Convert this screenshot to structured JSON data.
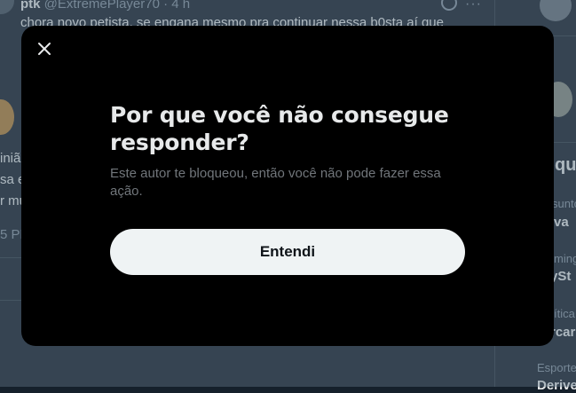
{
  "background": {
    "tweet": {
      "author_name": "ptk",
      "author_handle": "@ExtremePlayer70",
      "separator": "·",
      "time": "4 h",
      "text": "chora novo petista, se engana mesmo pra continuar nessa b0sta aí que"
    },
    "side_snippets": [
      "iniã",
      "sa e",
      "r mu"
    ],
    "side_time": "5 PM",
    "trends_heading": "qu",
    "trends": [
      {
        "category": "sunto",
        "name": "va"
      },
      {
        "category": "ming",
        "name": "ySt"
      },
      {
        "category": "ítica",
        "name": "rcar"
      },
      {
        "category": "Esporte",
        "name": "Derive"
      }
    ]
  },
  "modal": {
    "close_icon": "close-icon",
    "title": "Por que você não consegue responder?",
    "description": "Este autor te bloqueou, então você não pode fazer essa ação.",
    "button_label": "Entendi"
  }
}
